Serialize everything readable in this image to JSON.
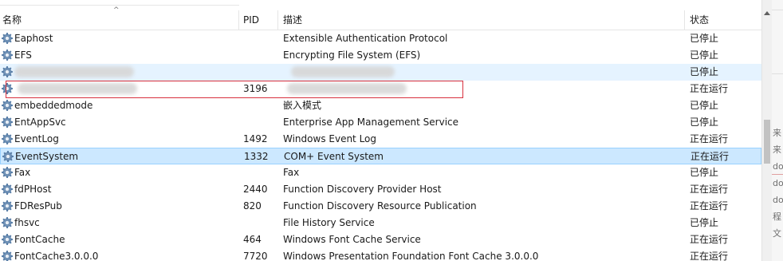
{
  "table": {
    "columns": {
      "name": "名称",
      "pid": "PID",
      "description": "描述",
      "status": "状态"
    },
    "rows": [
      {
        "name": "Eaphost",
        "pid": "",
        "description": "Extensible Authentication Protocol",
        "status": "已停止"
      },
      {
        "name": "EFS",
        "pid": "",
        "description": "Encrypting File System (EFS)",
        "status": "已停止"
      },
      {
        "name": "",
        "pid": "",
        "description": "",
        "status": "已停止"
      },
      {
        "name": "",
        "pid": "3196",
        "description": "",
        "status": "正在运行"
      },
      {
        "name": "embeddedmode",
        "pid": "",
        "description": "嵌入模式",
        "status": "已停止"
      },
      {
        "name": "EntAppSvc",
        "pid": "",
        "description": "Enterprise App Management Service",
        "status": "已停止"
      },
      {
        "name": "EventLog",
        "pid": "1492",
        "description": "Windows Event Log",
        "status": "正在运行"
      },
      {
        "name": "EventSystem",
        "pid": "1332",
        "description": "COM+ Event System",
        "status": "正在运行"
      },
      {
        "name": "Fax",
        "pid": "",
        "description": "Fax",
        "status": "已停止"
      },
      {
        "name": "fdPHost",
        "pid": "2440",
        "description": "Function Discovery Provider Host",
        "status": "正在运行"
      },
      {
        "name": "FDResPub",
        "pid": "820",
        "description": "Function Discovery Resource Publication",
        "status": "正在运行"
      },
      {
        "name": "fhsvc",
        "pid": "",
        "description": "File History Service",
        "status": "已停止"
      },
      {
        "name": "FontCache",
        "pid": "464",
        "description": "Windows Font Cache Service",
        "status": "正在运行"
      },
      {
        "name": "FontCache3.0.0.0",
        "pid": "7720",
        "description": "Windows Presentation Foundation Font Cache 3.0.0.0",
        "status": "正在运行"
      }
    ]
  },
  "background_window": {
    "visible_chars": [
      "来",
      "来",
      "do",
      "do",
      "do",
      "程",
      "文"
    ]
  },
  "icons": {
    "row_icon": "gear-icon",
    "sort_indicator": "sort-ascending-icon"
  },
  "colors": {
    "selection": "#cce8ff",
    "selection_border": "#99d1ff",
    "hover": "#e5f3ff",
    "highlight_box": "#d8313e"
  }
}
